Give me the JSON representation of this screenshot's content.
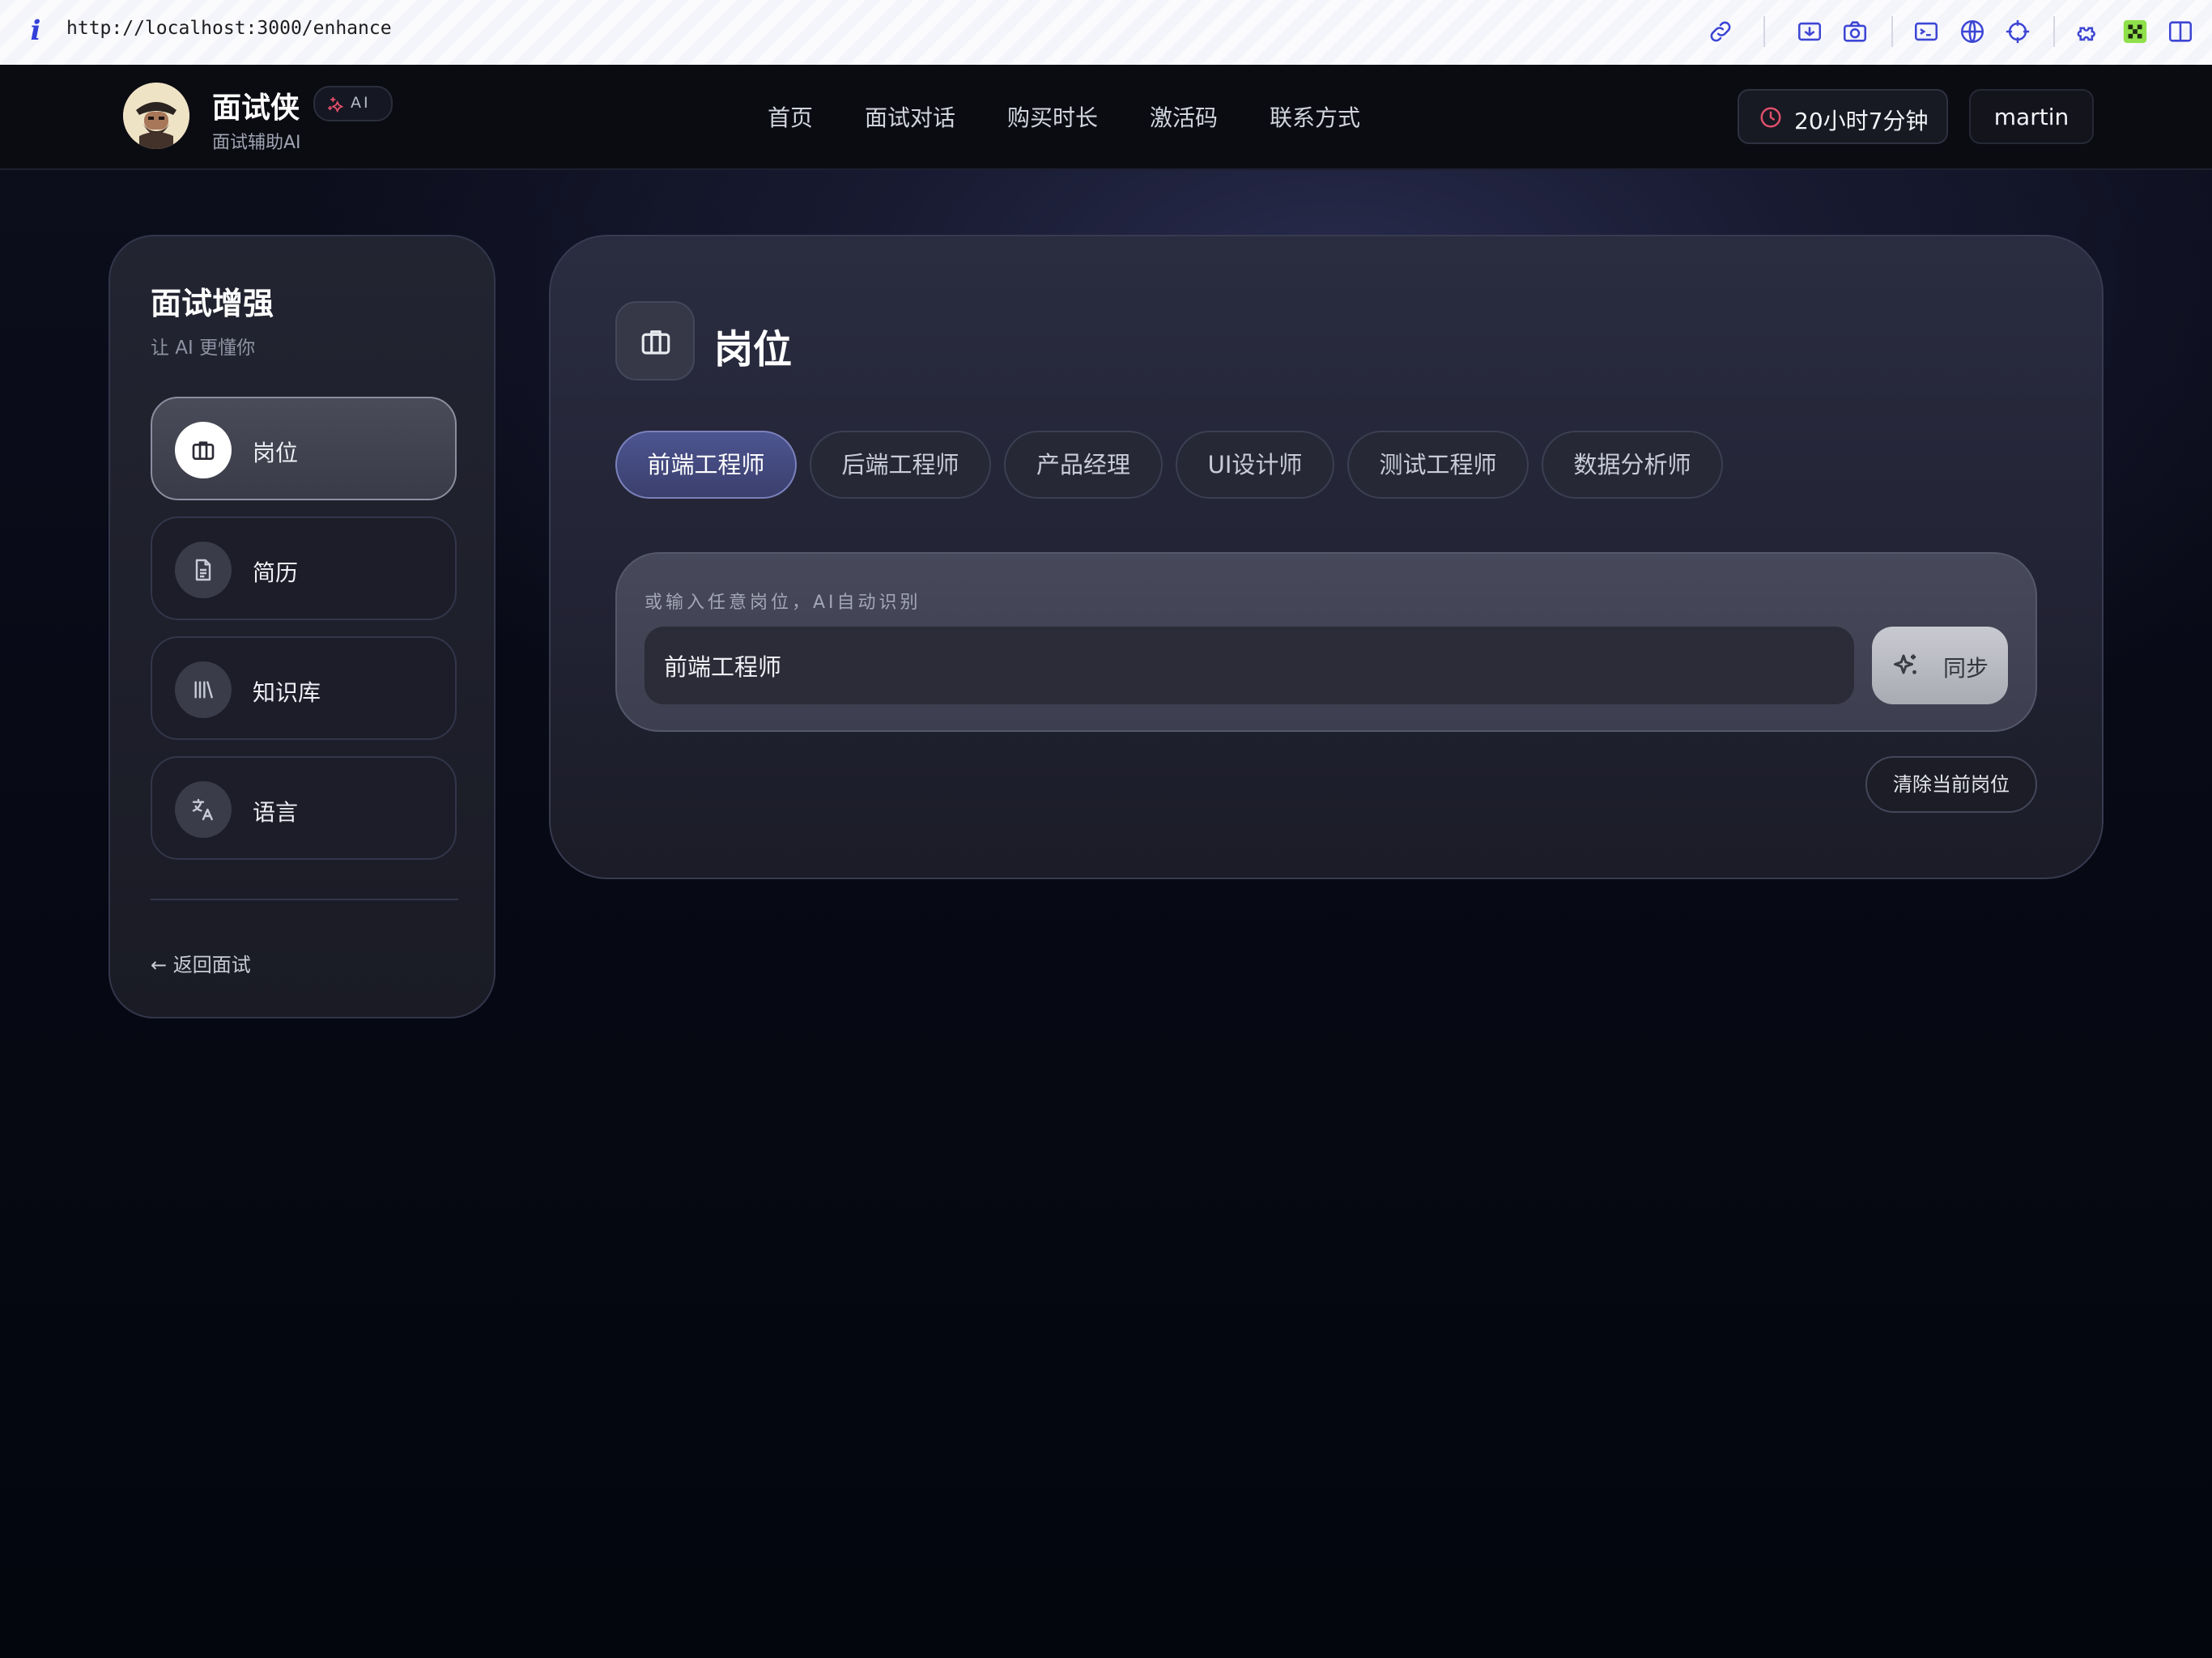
{
  "browser": {
    "url": "http://localhost:3000/enhance",
    "icons": [
      "info-icon",
      "link-icon",
      "screenshot-icon",
      "camera-icon",
      "terminal-icon",
      "globe-icon",
      "crosshair-icon",
      "extension-icon",
      "qr-icon",
      "sidebar-toggle-icon"
    ]
  },
  "nav": {
    "brand_name": "面试侠",
    "ai_badge": "AI",
    "brand_sub": "面试辅助AI",
    "links": [
      "首页",
      "面试对话",
      "购买时长",
      "激活码",
      "联系方式"
    ],
    "timer": "20小时7分钟",
    "user": "martin"
  },
  "sidebar": {
    "title": "面试增强",
    "subtitle": "让 AI 更懂你",
    "items": [
      {
        "label": "岗位",
        "icon": "briefcase-icon",
        "active": true
      },
      {
        "label": "简历",
        "icon": "document-icon",
        "active": false
      },
      {
        "label": "知识库",
        "icon": "library-icon",
        "active": false
      },
      {
        "label": "语言",
        "icon": "translate-icon",
        "active": false
      }
    ],
    "back": "← 返回面试"
  },
  "main": {
    "title": "岗位",
    "chips": [
      "前端工程师",
      "后端工程师",
      "产品经理",
      "UI设计师",
      "测试工程师",
      "数据分析师"
    ],
    "active_chip": "前端工程师",
    "input_hint": "或输入任意岗位，AI自动识别",
    "input_value": "前端工程师",
    "sync_label": "同步",
    "clear_label": "清除当前岗位"
  },
  "colors": {
    "accent_chip": "#4d5591",
    "timer_icon": "#e0506a",
    "ai_sparkle": "#e0506a",
    "background": "#0a0c18"
  }
}
